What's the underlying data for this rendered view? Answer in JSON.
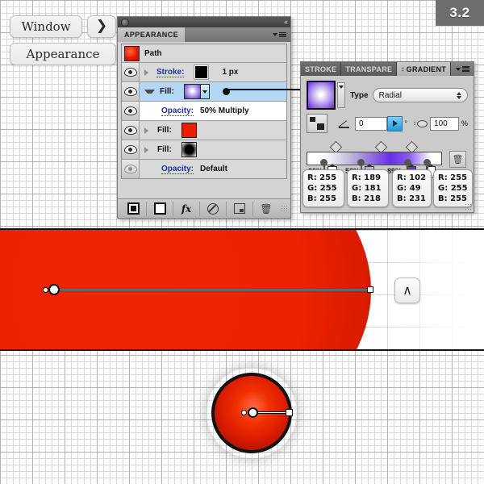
{
  "badge": {
    "version": "3.2"
  },
  "menu_buttons": {
    "window": "Window",
    "arrow_icon": "right-arrow-icon",
    "arrow_glyph": "❯",
    "appearance": "Appearance"
  },
  "appearance_panel": {
    "tab": "APPEARANCE",
    "collapse_glyph": "«",
    "header_row": {
      "label": "Path"
    },
    "rows": [
      {
        "name": "stroke",
        "label": "Stroke:",
        "value": "1 px",
        "swatch": "black-square-swatch",
        "selected": false
      },
      {
        "name": "fill-gradient",
        "label": "Fill:",
        "value": "",
        "swatch": "radial-gradient-swatch",
        "selected": true
      },
      {
        "name": "opacity-multiply",
        "label": "Opacity:",
        "value": "50% Multiply",
        "swatch": "",
        "selected": false
      },
      {
        "name": "fill-red",
        "label": "Fill:",
        "value": "",
        "swatch": "red-square-swatch",
        "selected": false
      },
      {
        "name": "fill-black-radial",
        "label": "Fill:",
        "value": "",
        "swatch": "black-radial-swatch",
        "selected": false
      },
      {
        "name": "opacity-default",
        "label": "Opacity:",
        "value": "Default",
        "swatch": "",
        "selected": false
      }
    ],
    "footer_buttons": [
      {
        "name": "add-new-stroke-button",
        "icon": "filled-square-icon"
      },
      {
        "name": "add-new-fill-button",
        "icon": "empty-square-icon"
      },
      {
        "name": "add-new-effect-button",
        "icon": "fx-icon",
        "glyph": "fx"
      },
      {
        "name": "clear-appearance-button",
        "icon": "no-symbol-icon"
      },
      {
        "name": "duplicate-item-button",
        "icon": "duplicate-icon"
      },
      {
        "name": "delete-item-button",
        "icon": "trash-icon",
        "glyph": "🗑"
      }
    ]
  },
  "gradient_panel": {
    "tabs": [
      {
        "label": "STROKE",
        "active": false
      },
      {
        "label": "TRANSPARE",
        "active": false
      },
      {
        "label": "GRADIENT",
        "active": true
      }
    ],
    "type_label": "Type",
    "type_value": "Radial",
    "angle_value": "0",
    "angle_unit": "°",
    "aspect_value": "100",
    "aspect_unit": "%",
    "reverse_button": "reverse-gradient-button",
    "delete_stop_button": "delete-stop-button",
    "stops": [
      {
        "position": "20%",
        "swatch_color": "#ffffff",
        "rgb": {
          "r": "R: 255",
          "g": "G: 255",
          "b": "B: 255"
        }
      },
      {
        "position": "53%",
        "swatch_color": "#bdb5da",
        "rgb": {
          "r": "R: 189",
          "g": "G: 181",
          "b": "B: 218"
        }
      },
      {
        "position": "89%",
        "swatch_color": "#6631e7",
        "rgb": {
          "r": "R: 102",
          "g": "G: 49",
          "b": "B: 231"
        }
      },
      {
        "position": "",
        "swatch_color": "#ffffff",
        "rgb": {
          "r": "R: 255",
          "g": "G: 255",
          "b": "B: 255"
        }
      }
    ]
  },
  "canvas": {
    "red_band_name": "radial-gradient-artwork-band",
    "gradient_handle_name": "gradient-annotator",
    "chevron_button": {
      "name": "collapse-chevron-button",
      "glyph": "∧"
    },
    "ball_name": "red-sphere-artwork"
  },
  "colors": {
    "accent_purple": "#6631e7",
    "red": "#ee2200",
    "panel_gray": "#cbcbcb",
    "link_blue": "#1d2ea8",
    "selection_blue": "#b4d7f5",
    "badge_gray": "#6e6e6e"
  }
}
